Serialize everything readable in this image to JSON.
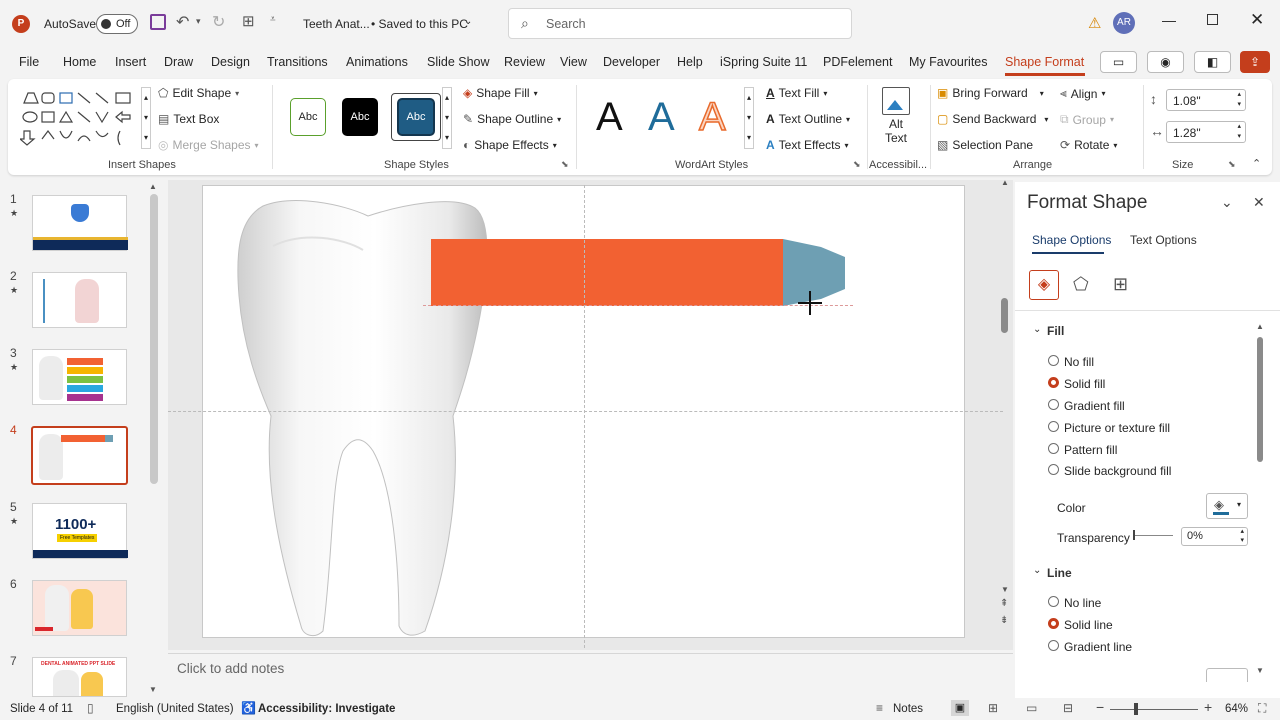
{
  "titlebar": {
    "autosave_label": "AutoSave",
    "autosave_state": "Off",
    "doc_title": "Teeth Anat...",
    "saved_status": "• Saved to this PC",
    "search_placeholder": "Search",
    "user_initials": "AR"
  },
  "tabs": [
    "File",
    "Home",
    "Insert",
    "Draw",
    "Design",
    "Transitions",
    "Animations",
    "Slide Show",
    "Review",
    "View",
    "Developer",
    "Help",
    "iSpring Suite 11",
    "PDFelement",
    "My Favourites",
    "Shape Format"
  ],
  "ribbon": {
    "insert_shapes": {
      "edit_shape": "Edit Shape",
      "text_box": "Text Box",
      "merge_shapes": "Merge Shapes",
      "label": "Insert Shapes"
    },
    "shape_styles": {
      "abc1": "Abc",
      "abc2": "Abc",
      "abc3": "Abc",
      "shape_fill": "Shape Fill",
      "shape_outline": "Shape Outline",
      "shape_effects": "Shape Effects",
      "label": "Shape Styles"
    },
    "wordart": {
      "a1": "A",
      "a2": "A",
      "a3": "A",
      "text_fill": "Text Fill",
      "text_outline": "Text Outline",
      "text_effects": "Text Effects",
      "label": "WordArt Styles"
    },
    "accessibility": {
      "alt_text_1": "Alt",
      "alt_text_2": "Text",
      "label": "Accessibil..."
    },
    "arrange": {
      "bring_forward": "Bring Forward",
      "send_backward": "Send Backward",
      "selection_pane": "Selection Pane",
      "align": "Align",
      "group": "Group",
      "rotate": "Rotate",
      "label": "Arrange"
    },
    "size": {
      "height": "1.08\"",
      "width": "1.28\"",
      "label": "Size"
    }
  },
  "slides": {
    "numbers": [
      "1",
      "2",
      "3",
      "4",
      "5",
      "6",
      "7"
    ],
    "thumb5_text1": "1100+",
    "thumb5_text2": "Free Templates",
    "thumb7_text": "DENTAL ANIMATED PPT SLIDE"
  },
  "notes_placeholder": "Click to add notes",
  "format_pane": {
    "title": "Format Shape",
    "tab_shape": "Shape Options",
    "tab_text": "Text Options",
    "fill_header": "Fill",
    "fill_options": [
      "No fill",
      "Solid fill",
      "Gradient fill",
      "Picture or texture fill",
      "Pattern fill",
      "Slide background fill"
    ],
    "color_label": "Color",
    "transparency_label": "Transparency",
    "transparency_value": "0%",
    "line_header": "Line",
    "line_options": [
      "No line",
      "Solid line",
      "Gradient line"
    ]
  },
  "status": {
    "slide_info": "Slide 4 of 11",
    "language": "English (United States)",
    "accessibility": "Accessibility: Investigate",
    "notes": "Notes",
    "zoom": "64%"
  },
  "colors": {
    "accent": "#c43e1c",
    "bar": "#f26132",
    "tip": "#6e9fb3"
  }
}
